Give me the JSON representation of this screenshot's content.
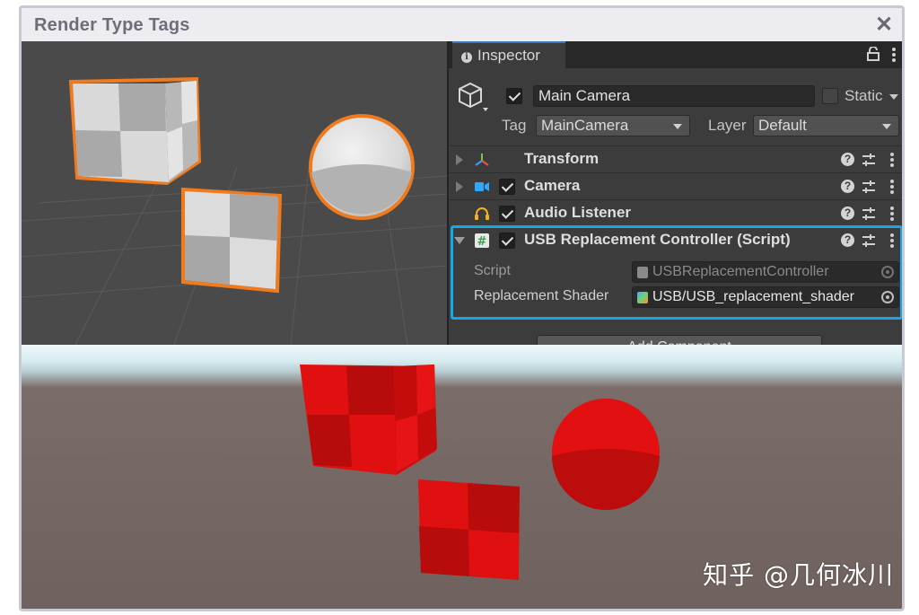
{
  "window": {
    "title": "Render Type Tags",
    "close_icon": "close-icon"
  },
  "inspector": {
    "tab_label": "Inspector",
    "object_name": "Main Camera",
    "active": true,
    "static_label": "Static",
    "tag_label": "Tag",
    "tag_value": "MainCamera",
    "layer_label": "Layer",
    "layer_value": "Default",
    "components": [
      {
        "name": "Transform",
        "icon": "transform-icon",
        "has_checkbox": false,
        "expanded": false
      },
      {
        "name": "Camera",
        "icon": "camera-icon",
        "has_checkbox": true,
        "enabled": true,
        "expanded": false
      },
      {
        "name": "Audio Listener",
        "icon": "headphones-icon",
        "has_checkbox": true,
        "enabled": true,
        "expanded": false
      },
      {
        "name": "USB Replacement Controller (Script)",
        "icon": "script-hash-icon",
        "has_checkbox": true,
        "enabled": true,
        "expanded": true
      }
    ],
    "script_props": {
      "script_label": "Script",
      "script_value": "USBReplacementController",
      "shader_label": "Replacement Shader",
      "shader_value": "USB/USB_replacement_shader"
    },
    "add_component_label": "Add Component"
  },
  "watermark": "知乎 @几何冰川",
  "colors": {
    "selection_outline": "#f07a1e",
    "highlight_box": "#16a8e6",
    "replacement_red": "#e01010",
    "inspector_bg": "#3c3c3c",
    "scene_bg": "#4a4a4a"
  }
}
